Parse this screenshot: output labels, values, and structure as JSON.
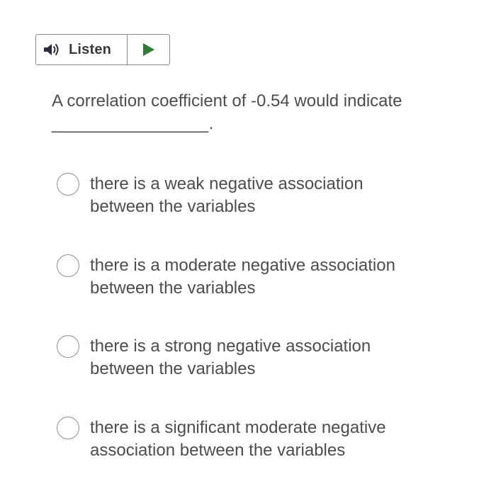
{
  "listen_widget": {
    "label": "Listen",
    "speaker_icon": "speaker-icon",
    "play_icon": "play-icon",
    "play_color": "#2e7d32"
  },
  "question": {
    "text": "A correlation coefficient of -0.54 would indicate",
    "blank": "________________."
  },
  "options": [
    {
      "line1": "there is a weak negative association",
      "line2": "between the variables"
    },
    {
      "line1": "there is a moderate negative association",
      "line2": "between the variables"
    },
    {
      "line1": "there is a strong negative association",
      "line2": "between the variables"
    },
    {
      "line1": "there is a significant moderate negative",
      "line2": "association between the variables"
    }
  ]
}
